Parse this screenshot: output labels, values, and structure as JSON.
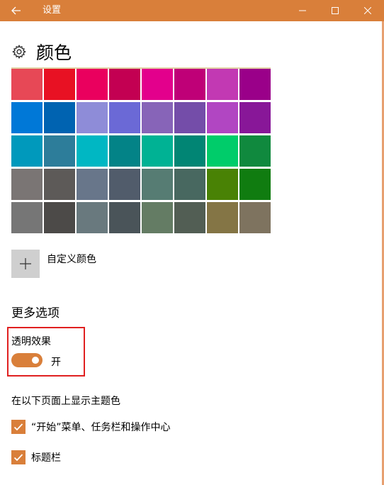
{
  "window": {
    "title": "设置",
    "accent_color": "#d97f3a"
  },
  "page": {
    "title": "颜色"
  },
  "swatches": [
    "#e74856",
    "#e81123",
    "#ea005e",
    "#c30052",
    "#e3008c",
    "#bf0077",
    "#c239b3",
    "#9a0089",
    "#0078d7",
    "#0063b1",
    "#8e8cd8",
    "#6b69d6",
    "#8764b8",
    "#744da9",
    "#b146c2",
    "#881798",
    "#0099bc",
    "#2d7d9a",
    "#00b7c3",
    "#038387",
    "#00b294",
    "#018574",
    "#00cc6a",
    "#10893e",
    "#7a7574",
    "#5d5a58",
    "#68768a",
    "#515c6b",
    "#567c73",
    "#486860",
    "#498205",
    "#107c10",
    "#767676",
    "#4c4a48",
    "#69797e",
    "#4a5459",
    "#647c64",
    "#525e54",
    "#847545",
    "#7e735f"
  ],
  "custom_color": {
    "label": "自定义颜色"
  },
  "more_options": {
    "heading": "更多选项",
    "transparency_label": "透明效果",
    "transparency_state": "开",
    "transparency_on": true,
    "show_accent_label": "在以下页面上显示主题色",
    "checkboxes": [
      {
        "label": "“开始”菜单、任务栏和操作中心",
        "checked": true
      },
      {
        "label": "标题栏",
        "checked": true
      }
    ]
  },
  "icons": {
    "back": "back-arrow-icon",
    "minimize": "minimize-icon",
    "maximize": "maximize-icon",
    "close": "close-icon",
    "gear": "gear-icon",
    "plus": "plus-icon",
    "check": "checkmark-icon"
  }
}
